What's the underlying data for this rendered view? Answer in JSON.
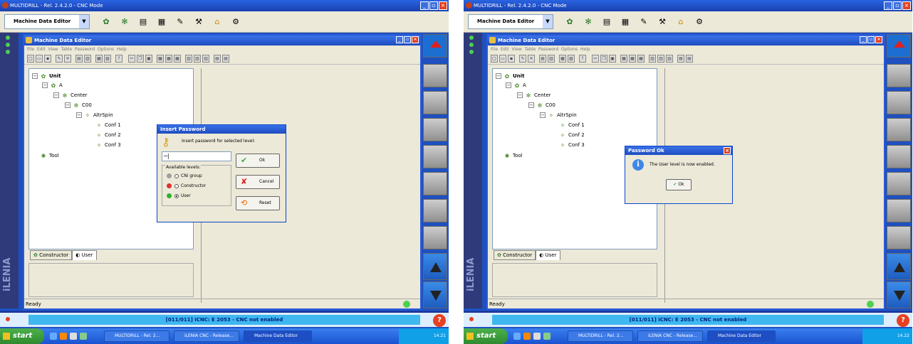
{
  "app_title": "MULTIDRILL - Rel. 2.4.2.0 - CNC Mode",
  "combo_value": "Machine Data Editor",
  "mde": {
    "title": "Machine Data Editor",
    "menu": "File  Edit  View  Table  Password  Options  Help",
    "status": "Ready"
  },
  "tree": {
    "unit": "Unit",
    "a": "A",
    "center": "Center",
    "c00": "C00",
    "spin": "AltrSpin",
    "conf1": "Conf 1",
    "conf2": "Conf 2",
    "conf3": "Conf 3",
    "tool": "Tool"
  },
  "tabs": {
    "constructor": "Constructor",
    "user": "User"
  },
  "message": "[011/011] iCNC: E 2053 - CNC not enabled",
  "brand": "iLENIA",
  "taskbar": {
    "start": "start",
    "t1": "MULTIDRILL - Rel. 2...",
    "t2": "iLENIA CNC - Release...",
    "t3": "Machine Data Editor",
    "clock1": "14.21",
    "clock2": "14.22"
  },
  "pwd_dialog": {
    "title": "Insert Password",
    "prompt": "Insert password for selected level:",
    "value": "─|",
    "levels_header": "Available levels:",
    "levels": [
      "CNi group",
      "Constructor",
      "User"
    ],
    "selected": "User",
    "level_colors": [
      "#a0a0a0",
      "#e03030",
      "#30b030"
    ],
    "ok": "Ok",
    "cancel": "Cancel",
    "reset": "Reset"
  },
  "ok_dialog": {
    "title": "Password Ok",
    "message": "The  User  level is now enabled.",
    "ok": "Ok"
  }
}
